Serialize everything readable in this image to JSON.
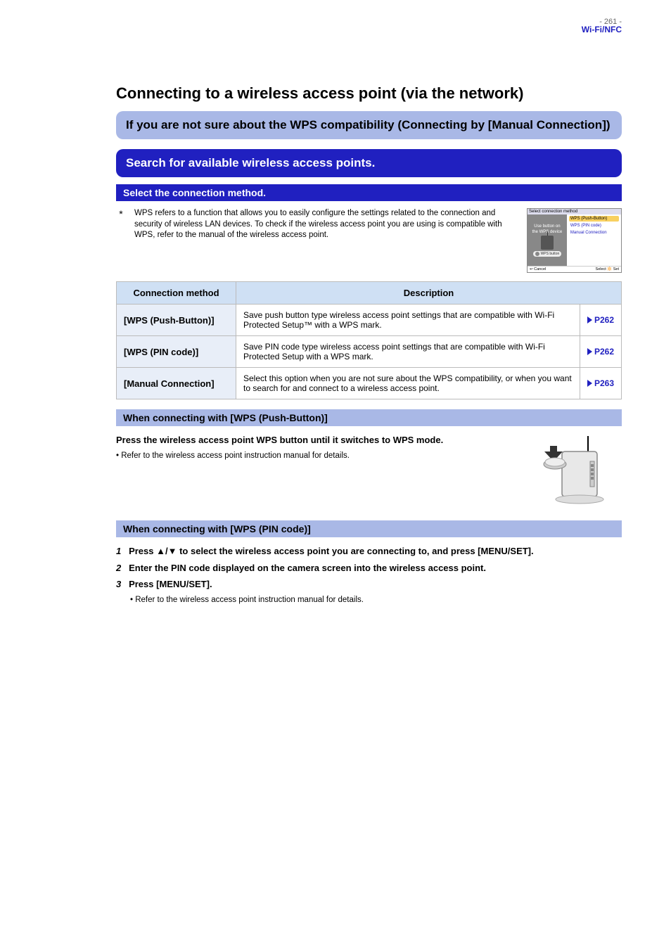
{
  "page": {
    "number": "- 261 -",
    "header": "Wi-Fi/NFC"
  },
  "title": "Connecting to a wireless access point (via the network)",
  "band1": "If you are not sure about the WPS compatibility (Connecting by [Manual Connection])",
  "band2": "Search for available wireless access points.",
  "bar1": "Select the connection method.",
  "note_star": "*",
  "note_text": "WPS refers to a function that allows you to easily configure the settings related to the connection and security of wireless LAN devices. To check if the wireless access point you are using is compatible with WPS, refer to the manual of the wireless access point.",
  "thumb": {
    "title": "Select connection method",
    "left1": "Use button on",
    "left2": "the WPS device",
    "wps": "WPS button",
    "opt1": "WPS (Push-Button)",
    "opt2": "WPS (PIN code)",
    "opt3": "Manual Connection",
    "cancel": "Cancel",
    "select": "Select",
    "set": "Set"
  },
  "table": {
    "h1": "Connection method",
    "h2": "Description",
    "r1m": "[WPS (Push-Button)]",
    "r1d": "Save push button type wireless access point settings that are compatible with Wi-Fi Protected Setup™ with a WPS mark.",
    "r1p": "P262",
    "r2m": "[WPS (PIN code)]",
    "r2d": "Save PIN code type wireless access point settings that are compatible with Wi-Fi Protected Setup with a WPS mark.",
    "r2p": "P262",
    "r3m": "[Manual Connection]",
    "r3d": "Select this option when you are not sure about the WPS compatibility, or when you want to search for and connect to a wireless access point.",
    "r3p": "P263"
  },
  "sec1": {
    "title": "When connecting with [WPS (Push-Button)]",
    "body_strong": "Press the wireless access point WPS button until it switches to WPS mode.",
    "bullet": "Refer to the wireless access point instruction manual for details."
  },
  "sec2": {
    "title": "When connecting with [WPS (PIN code)]",
    "step1_num": "1",
    "step1_a": "Press ",
    "step1_b": " to select the wireless access point you are connecting to, and press [MENU/SET].",
    "step2_num": "2",
    "step2": "Enter the PIN code displayed on the camera screen into the wireless access point.",
    "step3_num": "3",
    "step3": "Press [MENU/SET].",
    "bullet": "Refer to the wireless access point instruction manual for details."
  }
}
